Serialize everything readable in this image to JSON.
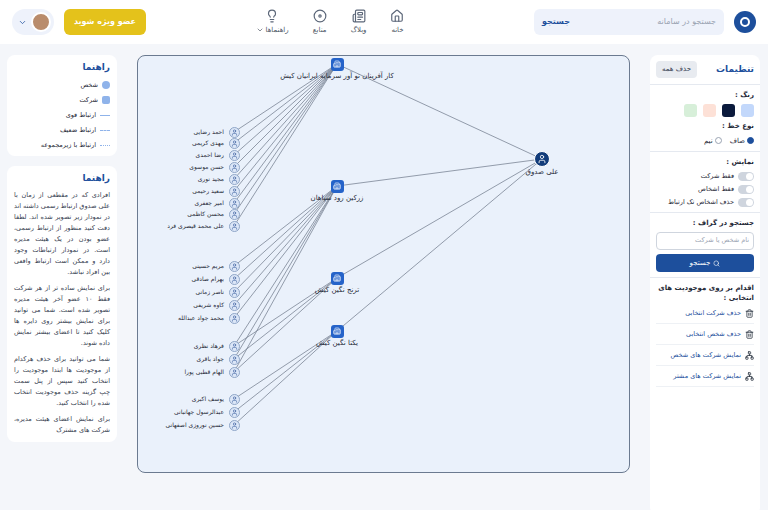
{
  "topbar": {
    "search": {
      "placeholder": "جستجو در سامانه",
      "button": "جستجو"
    },
    "nav": [
      {
        "label": "خانه",
        "dropdown": false
      },
      {
        "label": "وبلاگ",
        "dropdown": false
      },
      {
        "label": "منابع",
        "dropdown": false
      },
      {
        "label": "راهنماها",
        "dropdown": true
      }
    ],
    "premium_button": "عضو ویژه شوید"
  },
  "settings": {
    "title": "تنظیمات",
    "clear_button": "حذف همه",
    "color_label": "رنگ :",
    "colors": [
      {
        "color": "#c3d8fb"
      },
      {
        "color": "#0b1a3c"
      },
      {
        "color": "#fde1d7"
      },
      {
        "color": "#d7efd9"
      }
    ],
    "line_type_label": "نوع خط :",
    "line_types": [
      {
        "label": "صاف",
        "selected": true
      },
      {
        "label": "نیم",
        "selected": false
      }
    ],
    "display_label": "نمایش :",
    "toggles": [
      {
        "label": "فقط شرکت",
        "on": false
      },
      {
        "label": "فقط اشخاص",
        "on": false
      },
      {
        "label": "حذف اشخاص تک ارتباط",
        "on": false
      }
    ],
    "graph_search_label": "جستجو در گراف :",
    "graph_search_placeholder": "نام شخص یا شرکت",
    "graph_search_button": "جستجو",
    "actions_label": "اقدام بر روی موجودیت های انتخابی :",
    "actions": [
      {
        "label": "حذف شرکت انتخابی",
        "kind": "delete"
      },
      {
        "label": "حذف شخص انتخابی",
        "kind": "delete"
      },
      {
        "label": "نمایش شرکت های شخص",
        "kind": "network"
      },
      {
        "label": "نمایش شرکت های مشتر",
        "kind": "network"
      }
    ]
  },
  "legend": {
    "title": "راهنما",
    "items": [
      {
        "label": "شخص",
        "kind": "person"
      },
      {
        "label": "شرکت",
        "kind": "company"
      },
      {
        "label": "ارتباط قوی",
        "kind": "strong"
      },
      {
        "label": "ارتباط ضعیف",
        "kind": "weak"
      },
      {
        "label": "ارتباط با زیرمجموعه",
        "kind": "subsidiary"
      }
    ]
  },
  "help": {
    "title": "راهنما",
    "paragraphs": [
      "افرادی که در مقطعی از زمان با علی صدوق ارتباط رسمی داشته اند در نمودار زیر تصویر شده اند. لطفا دقت کنید منظور از ارتباط رسمی، عضو بودن در یک هیئت مدیره است. در نمودار ارتباطات وجود دارد و ممکن است ارتباط واقعی بین افراد نباشد.",
      "برای نمایش ساده تر از هر شرکت فقط ۱۰ عضو آخر هیئت مدیره تصویر شده است. شما می توانید برای نمایش بیشتر روی دایره ها کلیک کنید تا اعضای بیشتر نمایش داده شوند.",
      "شما می توانید برای حذف هرکدام از موجودیت ها ابتدا موجودیت را انتخاب کنید سپس از پنل سمت چپ گزینه حذف موجودیت انتخاب شده را انتخاب کنید.",
      "برای نمایش اعضای هیئت مدیره، شرکت های مشترک"
    ]
  },
  "graph": {
    "focus": {
      "name": "علی صدوق",
      "links": [
        0,
        1,
        2,
        3
      ]
    },
    "companies": [
      {
        "name": "کار آفرینان نو آور سرمایه ایرانیان کیش"
      },
      {
        "name": "زرکین رود سپاهان"
      },
      {
        "name": "ترنج نگین کیش"
      },
      {
        "name": "یکتا نگین کیش"
      }
    ],
    "people": [
      {
        "name": "احمد رضایی",
        "links": [
          0
        ]
      },
      {
        "name": "مهدی کریمی",
        "links": [
          0
        ]
      },
      {
        "name": "رضا احمدی",
        "links": [
          0
        ]
      },
      {
        "name": "حسن موسوی",
        "links": [
          0
        ]
      },
      {
        "name": "مجید نوری",
        "links": [
          0
        ]
      },
      {
        "name": "سعید رحیمی",
        "links": [
          0
        ]
      },
      {
        "name": "امیر جعفری",
        "links": [
          0
        ]
      },
      {
        "name": "محسن کاظمی",
        "links": [
          0
        ]
      },
      {
        "name": "علی محمد قیصری فرد",
        "links": [
          0
        ]
      },
      {
        "name": "مریم حسینی",
        "links": [
          1
        ]
      },
      {
        "name": "بهرام صادقی",
        "links": [
          1
        ]
      },
      {
        "name": "ناصر زمانی",
        "links": [
          1
        ]
      },
      {
        "name": "کاوه شریفی",
        "links": [
          1
        ]
      },
      {
        "name": "محمد جواد عبدالله",
        "links": [
          1
        ]
      },
      {
        "name": "فرهاد نظری",
        "links": [
          1,
          2
        ]
      },
      {
        "name": "جواد باقری",
        "links": [
          1,
          2
        ]
      },
      {
        "name": "الهام قطبی پورا",
        "links": [
          1,
          2
        ]
      },
      {
        "name": "یوسف اکبری",
        "links": [
          3
        ]
      },
      {
        "name": "عبدالرسول جهانبانی",
        "links": [
          3
        ]
      },
      {
        "name": "حسین نوروزی اصفهانی",
        "links": [
          3
        ]
      }
    ]
  }
}
